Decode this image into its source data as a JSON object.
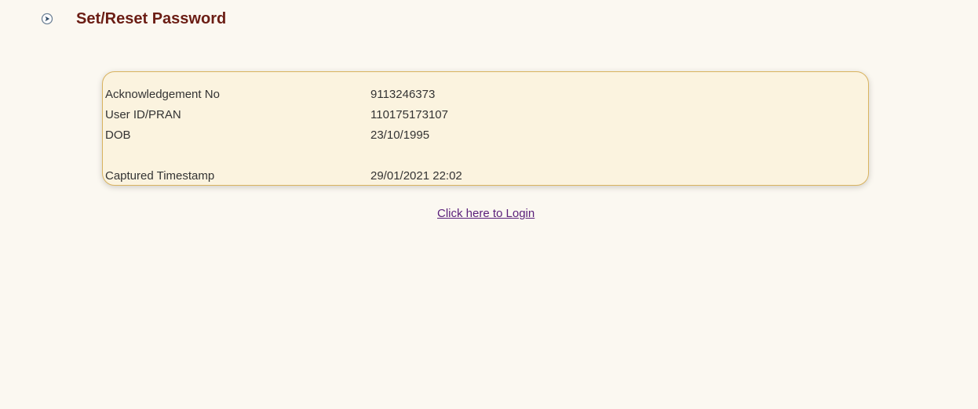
{
  "header": {
    "icon": "arrow-bullet-icon",
    "title": "Set/Reset Password"
  },
  "details": {
    "rows": [
      {
        "label": "Acknowledgement No",
        "value": "9113246373"
      },
      {
        "label": "User ID/PRAN",
        "value": "110175173107"
      },
      {
        "label": "DOB",
        "value": "23/10/1995"
      },
      {
        "label": "Captured Timestamp",
        "value": "29/01/2021 22:02"
      }
    ]
  },
  "login_link": "Click here to Login",
  "colors": {
    "title": "#6b1d14",
    "box_border": "#d9b35f",
    "box_background": "#fbf3df",
    "page_background": "#fbf8f1",
    "link": "#5a1f7a"
  }
}
